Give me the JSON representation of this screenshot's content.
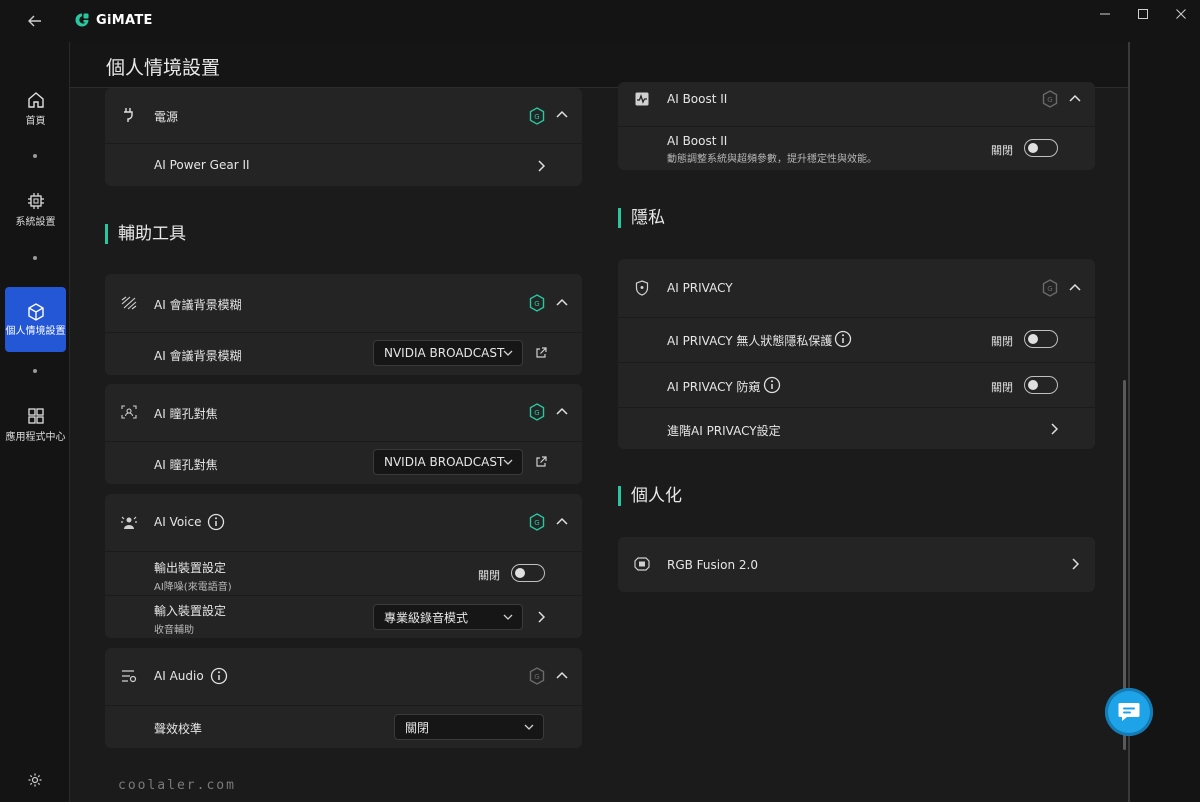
{
  "app": {
    "name": "GiMATE"
  },
  "page": {
    "title": "個人情境設置"
  },
  "sidebar": {
    "items": [
      {
        "label": "首頁",
        "icon": "home-icon"
      },
      {
        "label": "系統設置",
        "icon": "chip-icon"
      },
      {
        "label": "個人情境設置",
        "icon": "cube-icon",
        "active": true
      },
      {
        "label": "應用程式中心",
        "icon": "apps-grid-icon"
      }
    ]
  },
  "left": {
    "power": {
      "title": "電源",
      "item": "AI Power Gear II"
    },
    "tools_section": "輔助工具",
    "blur": {
      "title": "AI 會議背景模糊",
      "item": "AI 會議背景模糊",
      "value": "NVIDIA BROADCAST"
    },
    "eye": {
      "title": "AI 瞳孔對焦",
      "item": "AI 瞳孔對焦",
      "value": "NVIDIA BROADCAST"
    },
    "voice": {
      "title": "AI Voice",
      "out_label": "輸出裝置設定",
      "out_sub": "AI降噪(來電語音)",
      "out_state": "關閉",
      "in_label": "輸入裝置設定",
      "in_sub": "收音輔助",
      "in_value": "專業級錄音模式"
    },
    "audio": {
      "title": "AI Audio",
      "item": "聲效校準",
      "value": "關閉"
    }
  },
  "right": {
    "boost": {
      "title": "AI Boost II",
      "item": "AI Boost II",
      "desc": "動態調整系統與超頻參數，提升穩定性與效能。",
      "state": "關閉"
    },
    "privacy_section": "隱私",
    "privacy": {
      "title": "AI PRIVACY",
      "item1": "AI PRIVACY 無人狀態隱私保護",
      "item1_state": "關閉",
      "item2": "AI PRIVACY 防窺",
      "item2_state": "關閉",
      "item3": "進階AI PRIVACY設定"
    },
    "personal_section": "個人化",
    "rgb": {
      "title": "RGB Fusion 2.0"
    }
  },
  "watermark": "coolaler.com",
  "colors": {
    "accent": "#28c7a0",
    "active_nav": "#2457d6",
    "fab": "#1fa3e8"
  }
}
